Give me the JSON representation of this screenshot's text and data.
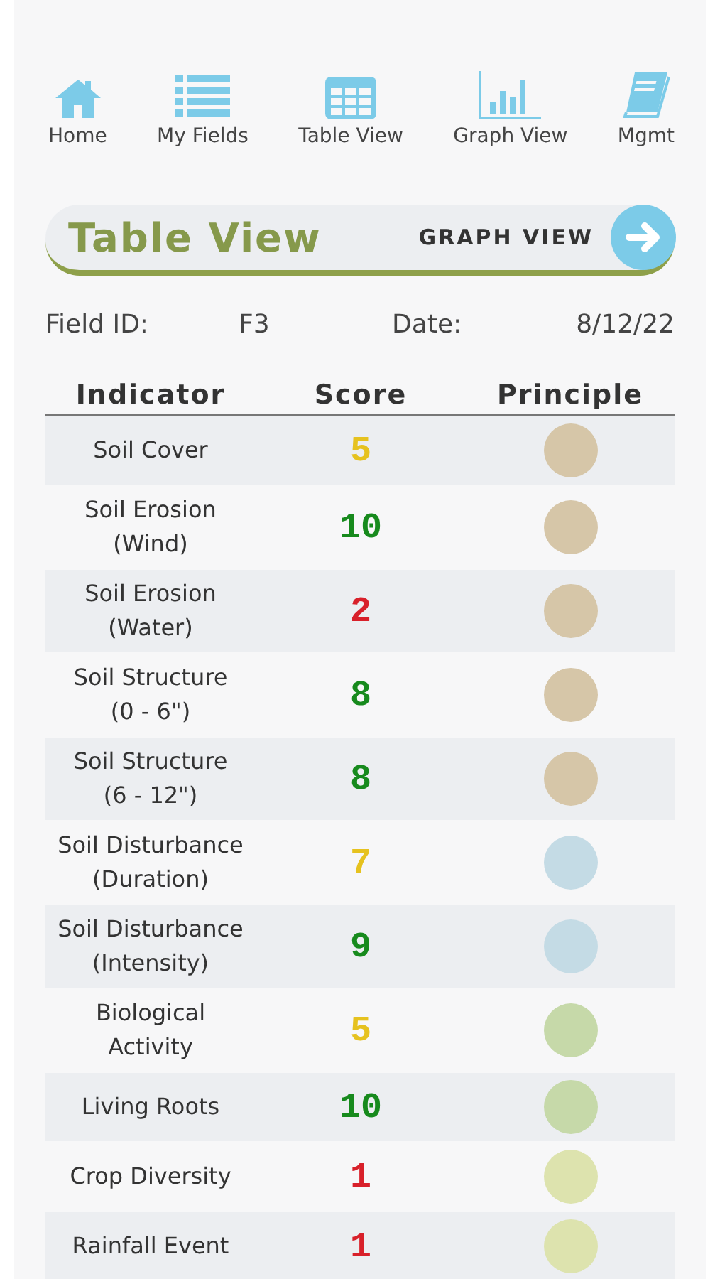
{
  "nav": [
    {
      "label": "Home",
      "kind": "home"
    },
    {
      "label": "My Fields",
      "kind": "list"
    },
    {
      "label": "Table View",
      "kind": "table"
    },
    {
      "label": "Graph View",
      "kind": "chart"
    },
    {
      "label": "Mgmt",
      "kind": "book"
    }
  ],
  "header": {
    "title": "Table View",
    "link": "GRAPH VIEW"
  },
  "info": {
    "field_label": "Field ID:",
    "field_value": "F3",
    "date_label": "Date:",
    "date_value": "8/12/22"
  },
  "table": {
    "columns": [
      "Indicator",
      "Score",
      "Principle"
    ],
    "rows": [
      {
        "indicator": "Soil Cover",
        "score": {
          "text": "5",
          "color": "#e6c21f"
        },
        "principle": {
          "color": "#d6c6a8"
        }
      },
      {
        "indicator": "Soil Erosion\n(Wind)",
        "score": {
          "text": "10",
          "color": "#178a1d"
        },
        "principle": {
          "color": "#d6c6a8"
        }
      },
      {
        "indicator": "Soil Erosion\n(Water)",
        "score": {
          "text": "2",
          "color": "#d8202a"
        },
        "principle": {
          "color": "#d6c6a8"
        }
      },
      {
        "indicator": "Soil Structure\n(0 - 6\")",
        "score": {
          "text": "8",
          "color": "#178a1d"
        },
        "principle": {
          "color": "#d6c6a8"
        }
      },
      {
        "indicator": "Soil Structure\n(6 - 12\")",
        "score": {
          "text": "8",
          "color": "#178a1d"
        },
        "principle": {
          "color": "#d6c6a8"
        }
      },
      {
        "indicator": "Soil Disturbance\n(Duration)",
        "score": {
          "text": "7",
          "color": "#e6c21f"
        },
        "principle": {
          "color": "#c4dbe5"
        }
      },
      {
        "indicator": "Soil Disturbance\n(Intensity)",
        "score": {
          "text": "9",
          "color": "#178a1d"
        },
        "principle": {
          "color": "#c4dbe5"
        }
      },
      {
        "indicator": "Biological\nActivity",
        "score": {
          "text": "5",
          "color": "#e6c21f"
        },
        "principle": {
          "color": "#c6d9a9"
        }
      },
      {
        "indicator": "Living Roots",
        "score": {
          "text": "10",
          "color": "#178a1d"
        },
        "principle": {
          "color": "#c6d9a9"
        }
      },
      {
        "indicator": "Crop Diversity",
        "score": {
          "text": "1",
          "color": "#d8202a"
        },
        "principle": {
          "color": "#dde3ae"
        }
      },
      {
        "indicator": "Rainfall Event",
        "score": {
          "text": "1",
          "color": "#d8202a"
        },
        "principle": {
          "color": "#dde3ae"
        }
      }
    ]
  }
}
